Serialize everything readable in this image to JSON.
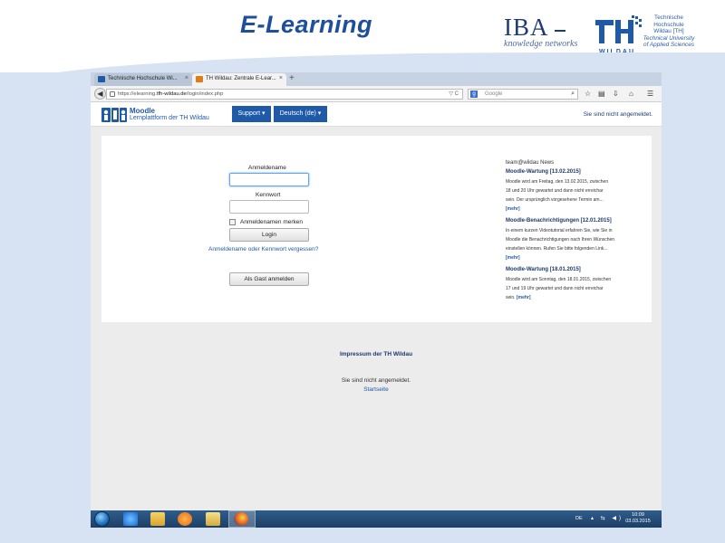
{
  "slide": {
    "title": "E-Learning",
    "iba_logo": {
      "text": "IBA",
      "subtitle": "knowledge networks"
    },
    "thw_logo": {
      "name_lines": [
        "Technische",
        "Hochschule",
        "Wildau [TH]"
      ],
      "english_lines": [
        "Technical University",
        "of Applied Sciences"
      ],
      "wordmark": "WILDAU"
    }
  },
  "browser": {
    "tabs": [
      {
        "label": "Technische Hochschule Wi...",
        "close": "×"
      },
      {
        "label": "TH Wildau: Zentrale E-Lear...",
        "close": "×"
      }
    ],
    "new_tab": "+",
    "url": {
      "prefix": "https://elearning.",
      "host": "tfh-wildau.de",
      "path": "/login/index.php"
    },
    "url_icons": "▽ C",
    "search": {
      "engine": "g",
      "placeholder": "Google"
    }
  },
  "moodle": {
    "brand": "Moodle",
    "brand_sub": "Lernplattform der TH Wildau",
    "nav_support": "Support ▾",
    "nav_language": "Deutsch (de) ▾",
    "login_status": "Sie sind nicht angemeldet."
  },
  "login": {
    "username_label": "Anmeldename",
    "password_label": "Kennwort",
    "remember_label": "Anmeldenamen merken",
    "login_button": "Login",
    "forgot_link": "Anmeldename oder Kennwort vergessen?",
    "guest_button": "Als Gast anmelden"
  },
  "news": {
    "heading": "team@wildau News",
    "items": [
      {
        "title": "Moodle-Wartung [13.02.2015]",
        "lines": [
          "Moodle wird am Freitag, den 13.02.2015, zwischen",
          "18 und 20 Uhr gewartet und dann nicht erreichar",
          "sein. Der ursprünglich vorgesehene Termin am...",
          ""
        ],
        "more": "[mehr]"
      },
      {
        "title": "Moodle-Benachrichtigungen [12.01.2015]",
        "lines": [
          "In einem kurzen Videotutorial erfahren Sie, wie Sie in",
          "Moodle die Benachrichtigungen nach Ihren Wünschen",
          "einstellen können. Rufen Sie bitte folgenden Link...",
          ""
        ],
        "more": "[mehr]"
      },
      {
        "title": "Moodle-Wartung [18.01.2015]",
        "lines": [
          "Moodle wird am Sonntag, den 18.01.2015, zwischen",
          "17 und 19 Uhr gewartet und dann nicht erreichar",
          "sein. "
        ],
        "more": "[mehr]"
      }
    ]
  },
  "footer": {
    "impressum": "Impressum der TH Wildau",
    "status": "Sie sind nicht angemeldet.",
    "home_link": "Startseite"
  },
  "taskbar": {
    "language": "DE",
    "tray_icons": "▴ ⇆ ◀)",
    "time": "10:09",
    "date": "03.03.2015"
  }
}
